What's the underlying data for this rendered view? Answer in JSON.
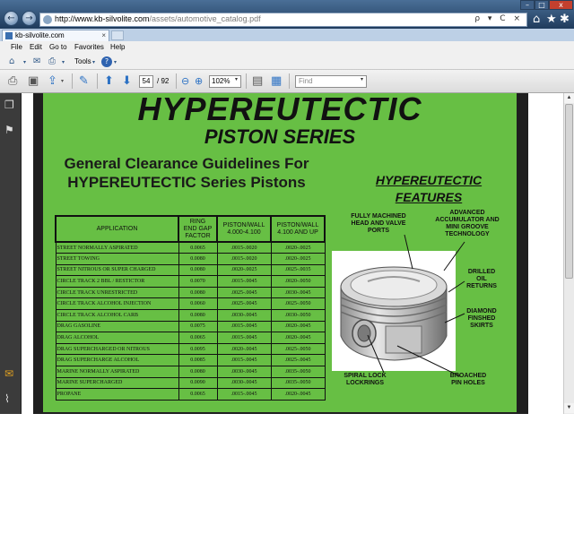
{
  "browser": {
    "url_host": "http://www.kb-silvolite.com",
    "url_path": "/assets/automotive_catalog.pdf",
    "address_actions": "ρ ▾ C ×",
    "tab_title": "kb-silvolite.com",
    "tab_close": "×",
    "back_glyph": "←",
    "forward_glyph": "→",
    "win_minimize": "–",
    "win_maximize": "□",
    "win_close": "x",
    "home_glyph": "⌂",
    "favorites_glyph": "★",
    "settings_glyph": "✱"
  },
  "menu": {
    "items": [
      "File",
      "Edit",
      "Go to",
      "Favorites",
      "Help"
    ]
  },
  "command_bar": {
    "tools_label": "Tools",
    "help_glyph": "?"
  },
  "pdf_toolbar": {
    "current_page": "54",
    "page_total": "/ 92",
    "zoom": "102%",
    "find_placeholder": "Find"
  },
  "document": {
    "title": "HYPEREUTECTIC",
    "subtitle": "PISTON SERIES",
    "guidelines_heading": "General Clearance Guidelines For HYPEREUTECTIC Series Pistons",
    "features_heading_line1": "HYPEREUTECTIC",
    "features_heading_line2": "FEATURES",
    "callouts": {
      "machined_line1": "FULLY MACHINED",
      "machined_line2": "HEAD AND VALVE",
      "machined_line3": "PORTS",
      "advanced_line1": "ADVANCED",
      "advanced_line2": "ACCUMULATOR AND",
      "advanced_line3": "MINI GROOVE",
      "advanced_line4": "TECHNOLOGY",
      "drilled_line1": "DRILLED",
      "drilled_line2": "OIL",
      "drilled_line3": "RETURNS",
      "diamond_line1": "DIAMOND",
      "diamond_line2": "FINSHED",
      "diamond_line3": "SKIRTS",
      "spiral_line1": "SPIRAL LOCK",
      "spiral_line2": "LOCKRINGS",
      "broached_line1": "BROACHED",
      "broached_line2": "PIN HOLES"
    },
    "table": {
      "headers": [
        {
          "line1": "APPLICATION",
          "line2": "",
          "line3": ""
        },
        {
          "line1": "RING",
          "line2": "END GAP",
          "line3": "FACTOR"
        },
        {
          "line1": "PISTON/WALL",
          "line2": "4.000-4.100",
          "line3": ""
        },
        {
          "line1": "PISTON/WALL",
          "line2": "4.100 AND UP",
          "line3": ""
        }
      ],
      "rows": [
        [
          "STREET NORMALLY ASPIRATED",
          "0.0065",
          ".0015-.0020",
          ".0020-.0025"
        ],
        [
          "STREET TOWING",
          "0.0080",
          ".0015-.0020",
          ".0020-.0025"
        ],
        [
          "STREET NITROUS OR SUPER CHARGED",
          "0.0080",
          ".0020-.0025",
          ".0025-.0035"
        ],
        [
          "CIRCLE TRACK 2 BBL / RESTICTOR",
          "0.0070",
          ".0015-.0045",
          ".0020-.0050"
        ],
        [
          "CIRCLE TRACK UNRESTRICTED",
          "0.0080",
          ".0025-.0045",
          ".0030-.0045"
        ],
        [
          "CIRCLE TRACK ALCOHOL INJECTION",
          "0.0060",
          ".0025-.0045",
          ".0025-.0050"
        ],
        [
          "CIRCLE TRACK ALCOHOL CARB",
          "0.0080",
          ".0030-.0045",
          ".0030-.0050"
        ],
        [
          "DRAG GASOLINE",
          "0.0075",
          ".0015-.0045",
          ".0020-.0045"
        ],
        [
          "DRAG ALCOHOL",
          "0.0065",
          ".0015-.0045",
          ".0020-.0045"
        ],
        [
          "DRAG SUPERCHARGED OR NITROUS",
          "0.0095",
          ".0020-.0045",
          ".0025-.0050"
        ],
        [
          "DRAG SUPERCHARGE ALCOHOL",
          "0.0085",
          ".0015-.0045",
          ".0025-.0045"
        ],
        [
          "MARINE NORMALLY ASPIRATED",
          "0.0080",
          ".0030-.0045",
          ".0035-.0050"
        ],
        [
          "MARINE SUPERCHARGED",
          "0.0090",
          ".0030-.0045",
          ".0035-.0050"
        ],
        [
          "PROPANE",
          "0.0065",
          ".0015-.0045",
          ".0020-.0045"
        ]
      ]
    }
  },
  "colors": {
    "page_green": "#67bf44",
    "titlebar_blue": "#1f3b5c"
  }
}
